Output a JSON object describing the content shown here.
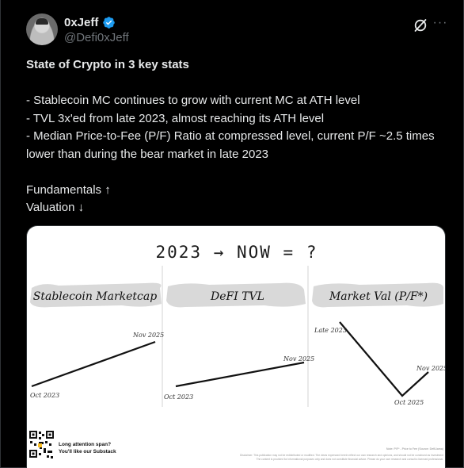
{
  "author": {
    "display_name": "0xJeff",
    "handle": "@Defi0xJeff",
    "verified": true,
    "avatar_icon": "avatar-photo"
  },
  "actions": {
    "grok_icon": "grok-icon",
    "more_icon": "more-icon",
    "more_label": "···"
  },
  "tweet": {
    "title": "State of Crypto in 3 key stats",
    "bullets": [
      "- Stablecoin MC continues to grow with current MC at ATH level",
      "- TVL 3x'ed from late 2023, almost reaching its ATH level",
      "- Median Price-to-Fee (P/F) Ratio at compressed level, current P/F ~2.5 times lower than during the bear market in late 2023"
    ],
    "fundamentals": "Fundamentals ↑",
    "valuation": "Valuation ↓"
  },
  "media": {
    "headline": "2023 → NOW = ?",
    "panels": [
      {
        "title": "Stablecoin Marketcap",
        "start_label": "Oct 2023",
        "end_label": "Nov 2025"
      },
      {
        "title": "DeFI TVL",
        "start_label": "Oct 2023",
        "end_label": "Nov 2025"
      },
      {
        "title": "Market Val (P/F*)",
        "start_label": "Late 2023",
        "mid_label": "Oct 2025",
        "end_label": "Nov 2025"
      }
    ],
    "promo_line1": "Long attention span?",
    "promo_line2": "You'll like our Substack",
    "footnote": "Note: P/F* - Price to Fee (Source: DefiLlama)",
    "disclaimer_1": "Disclaimer: This publication may not be redistributed or modified. The views expressed herein reflect our own research and opinions, and should not be construed as investment",
    "disclaimer_2": "The content is provided for informational purposes only and does not constitute financial advice. Please do your own research and consult a licensed professional."
  },
  "colors": {
    "verified_badge": "#1d9bf0",
    "background": "#000000",
    "text": "#e7e9ea",
    "muted": "#71767b"
  }
}
